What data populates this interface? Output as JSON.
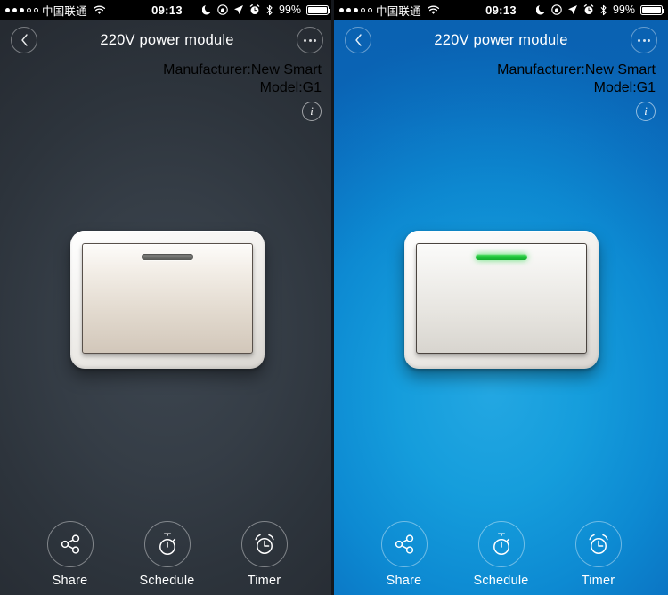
{
  "statusbar": {
    "signal_dots_filled": 3,
    "signal_dots_total": 5,
    "carrier": "中国联通",
    "wifi_icon": "wifi-icon",
    "time": "09:13",
    "icons": [
      "moon-icon",
      "rotation-lock-icon",
      "location-arrow-icon",
      "alarm-clock-icon",
      "bluetooth-icon"
    ],
    "battery_percent": "99%",
    "battery_icon": "battery-full-icon"
  },
  "header": {
    "back_icon": "chevron-left-icon",
    "title": "220V power module",
    "more_icon": "more-dots-icon",
    "manufacturer": "Manufacturer:New Smart",
    "model": "Model:G1",
    "info_icon": "info-icon",
    "info_label": "i"
  },
  "device": {
    "type": "wall-rocker-switch",
    "states": [
      {
        "name": "off",
        "led_color": "#6f706d",
        "panel_background": "#353d46"
      },
      {
        "name": "on",
        "led_color": "#22c93e",
        "panel_background": "#0d8ad2"
      }
    ]
  },
  "bottombar": {
    "items": [
      {
        "icon": "share-nodes-icon",
        "label": "Share"
      },
      {
        "icon": "stopwatch-icon",
        "label": "Schedule"
      },
      {
        "icon": "alarm-clock-icon",
        "label": "Timer"
      }
    ]
  },
  "colors": {
    "dark_panel_center": "#3d4650",
    "dark_panel_edge": "#262b32",
    "blue_panel_center": "#23a7e2",
    "blue_panel_edge": "#0a66b8",
    "led_on": "#22c93e",
    "led_off": "#6f706d",
    "statusbar_bg": "#000000",
    "text": "#ffffff"
  }
}
